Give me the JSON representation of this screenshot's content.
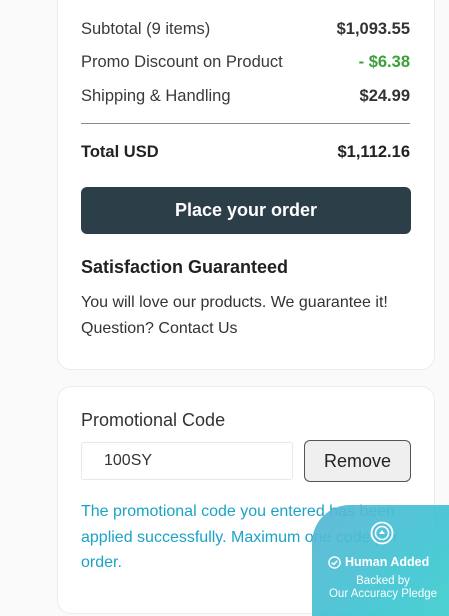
{
  "summary": {
    "subtotal_label": "Subtotal (9 items)",
    "subtotal_value": "$1,093.55",
    "promo_label": "Promo Discount on Product",
    "promo_value": "- $6.38",
    "shipping_label": "Shipping & Handling",
    "shipping_value": "$24.99",
    "total_label": "Total USD",
    "total_value": "$1,112.16",
    "place_order_label": "Place your order"
  },
  "satisfaction": {
    "title": "Satisfaction Guaranteed",
    "line1": "You will love our products. We guarantee it!",
    "line2": "Question? Contact Us"
  },
  "promo": {
    "title": "Promotional Code",
    "code_value": "100SY",
    "remove_label": "Remove",
    "message": "The promotional code you entered has been applied successfully. Maximum one code per order."
  },
  "badge": {
    "title": "Human Added",
    "line1": "Backed by",
    "line2": "Our Accuracy Pledge",
    "icon": "check-circle-icon"
  },
  "colors": {
    "button_bg": "#2c3e48",
    "discount": "#3aa13a",
    "promo_message": "#1aa3c7",
    "badge": "#3fc6d2"
  }
}
